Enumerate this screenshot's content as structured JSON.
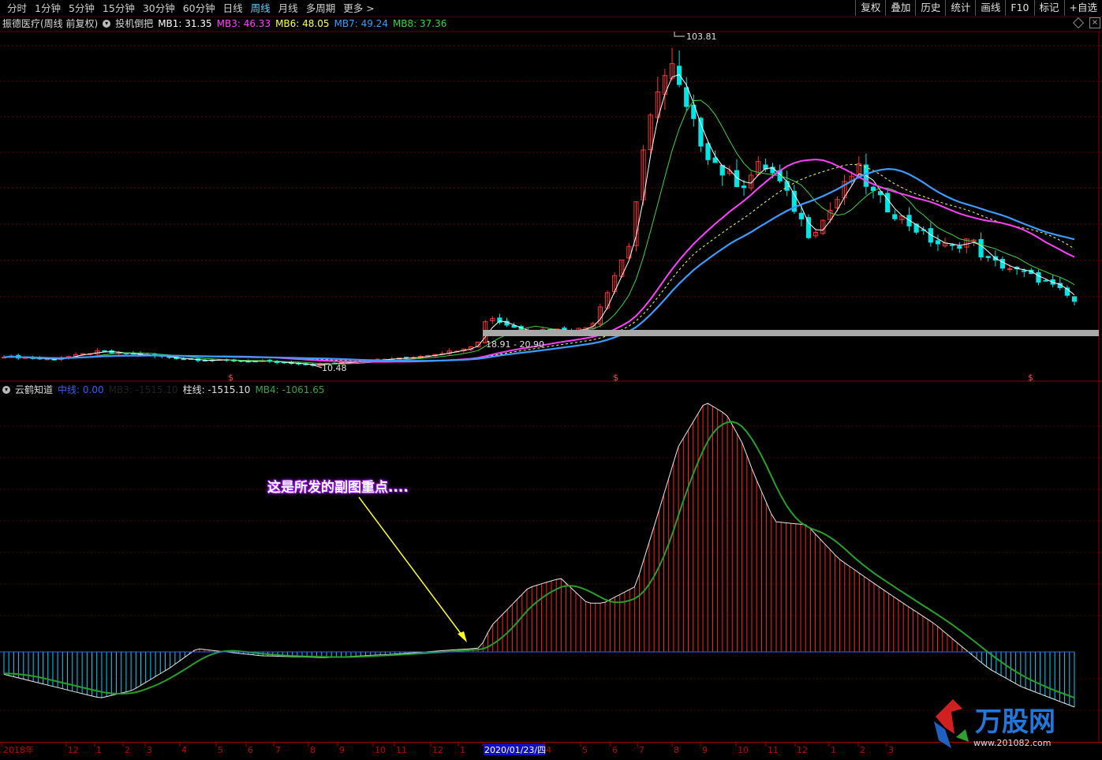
{
  "toolbar": {
    "periods": [
      "分时",
      "1分钟",
      "5分钟",
      "15分钟",
      "30分钟",
      "60分钟",
      "日线",
      "周线",
      "月线",
      "多周期",
      "更多 >"
    ],
    "active_period": "周线",
    "right_buttons": [
      "复权",
      "叠加",
      "历史",
      "统计",
      "画线",
      "F10",
      "标记",
      "+自选"
    ]
  },
  "main_panel": {
    "stock_title": "振德医疗(周线 前复权)",
    "indicator_name": "投机倒把",
    "legend": [
      {
        "label": "MB1: 31.35",
        "color": "#ffffff"
      },
      {
        "label": "MB3: 46.33",
        "color": "#ff40ff"
      },
      {
        "label": "MB6: 48.05",
        "color": "#ffff60"
      },
      {
        "label": "MB7: 49.24",
        "color": "#3a9cff"
      },
      {
        "label": "MB8: 37.36",
        "color": "#3fd23f"
      }
    ],
    "peak_label": "103.81",
    "low_label": "10.48",
    "range_label": "18.91 - 20.90",
    "dollar_marker": "$"
  },
  "sub_panel": {
    "indicator_name": "云鹤知道",
    "legend": [
      {
        "label": "中线: 0.00",
        "color": "#3060ff"
      },
      {
        "label": "MB3: -1515.10",
        "color": "#202020"
      },
      {
        "label": "柱线: -1515.10",
        "color": "#e0e0e0"
      },
      {
        "label": "MB4: -1061.65",
        "color": "#3fa03f"
      }
    ]
  },
  "annotation": {
    "text": "这是所发的副图重点...."
  },
  "xaxis": {
    "labels": [
      "2018年",
      "12",
      "1",
      "2",
      "3",
      "4",
      "5",
      "6",
      "7",
      "8",
      "9",
      "10",
      "11",
      "12",
      "1",
      "2020/01/23/四",
      "4",
      "5",
      "6",
      "7",
      "8",
      "9",
      "10",
      "11",
      "12",
      "1",
      "2",
      "3"
    ],
    "highlight": "2020/01/23/四"
  },
  "logo": {
    "text": "万股网",
    "url_text": "www.201082.com"
  },
  "colors": {
    "up": "#ff3232",
    "down": "#00e5e5",
    "mb1": "#ffffff",
    "mb3": "#ff40ff",
    "mb6": "#ffff60",
    "mb7": "#3a9cff",
    "mb8": "#3fd23f",
    "hist_up": "#ff2020",
    "hist_down": "#00d0ff"
  },
  "chart_data": [
    {
      "type": "candlestick",
      "title": "振德医疗(周线 前复权)",
      "series_count": 150,
      "date_range": [
        "2018-11",
        "2021-03"
      ],
      "annotated_extremes": {
        "high": 103.81,
        "low": 10.48
      },
      "highlighted_range": [
        18.91,
        20.9
      ],
      "x": [
        "2018-11",
        "2019-01",
        "2019-04",
        "2019-07",
        "2019-10",
        "2020-01",
        "2020-02",
        "2020-03",
        "2020-04",
        "2020-05",
        "2020-06",
        "2020-07",
        "2020-08",
        "2020-09",
        "2020-10",
        "2020-11",
        "2020-12",
        "2021-01",
        "2021-02",
        "2021-03"
      ],
      "close": [
        13.5,
        12.8,
        14.5,
        12.2,
        11.0,
        13.5,
        25.0,
        22.0,
        20.5,
        45.0,
        85.0,
        78.0,
        66.0,
        60.0,
        53.0,
        60.0,
        48.0,
        44.0,
        35.0,
        26.0
      ],
      "ma_latest": {
        "MB1": 31.35,
        "MB3": 46.33,
        "MB6": 48.05,
        "MB7": 49.24,
        "MB8": 37.36
      }
    },
    {
      "type": "bar",
      "title": "云鹤知道",
      "x": [
        "2018-11",
        "2019-01",
        "2019-04",
        "2019-07",
        "2019-10",
        "2020-01",
        "2020-03",
        "2020-05",
        "2020-07",
        "2020-09",
        "2020-11",
        "2021-01",
        "2021-03"
      ],
      "series": [
        {
          "name": "柱线",
          "values": [
            -1500,
            -800,
            0,
            -300,
            -100,
            200,
            2600,
            1800,
            8300,
            6500,
            4200,
            2000,
            -1515.1
          ]
        },
        {
          "name": "MB4",
          "values": [
            -1200,
            -900,
            -200,
            -300,
            -150,
            100,
            1800,
            2200,
            7600,
            6000,
            4000,
            1800,
            -1061.65
          ]
        }
      ],
      "zero_line": 0
    }
  ]
}
